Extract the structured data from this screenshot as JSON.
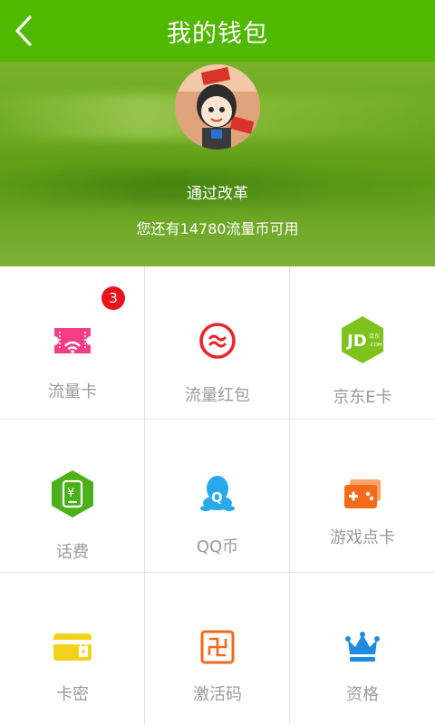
{
  "header": {
    "title": "我的钱包",
    "back_icon": "back-chevron-icon"
  },
  "banner": {
    "user_name": "通过改革",
    "balance_text": "您还有14780流量币可用"
  },
  "colors": {
    "brand": "#51b800",
    "label_gray": "#9a9a9a",
    "badge_red": "#e8141c"
  },
  "menu": {
    "items": [
      {
        "label": "流量卡",
        "icon": "data-card-icon",
        "badge": "3"
      },
      {
        "label": "流量红包",
        "icon": "red-envelope-icon"
      },
      {
        "label": "京东E卡",
        "icon": "jd-icon"
      },
      {
        "label": "话费",
        "icon": "phone-bill-icon"
      },
      {
        "label": "QQ币",
        "icon": "qq-icon"
      },
      {
        "label": "游戏点卡",
        "icon": "game-card-icon"
      },
      {
        "label": "卡密",
        "icon": "card-password-icon"
      },
      {
        "label": "激活码",
        "icon": "activation-code-icon"
      },
      {
        "label": "资格",
        "icon": "crown-icon"
      }
    ]
  }
}
